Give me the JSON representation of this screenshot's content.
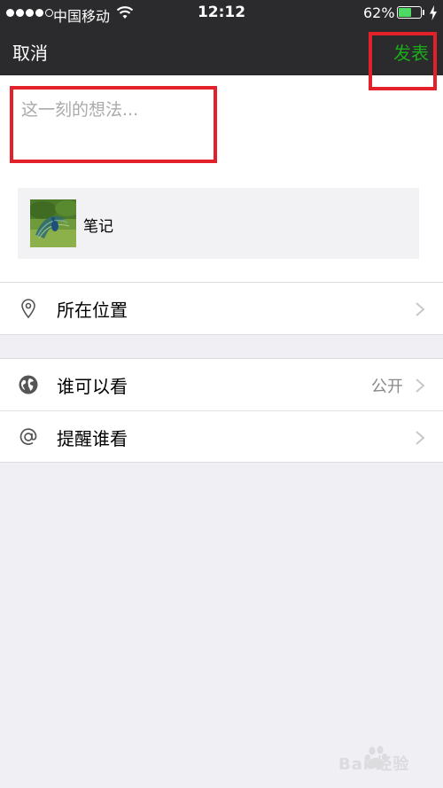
{
  "status_bar": {
    "carrier": "中国移动",
    "time": "12:12",
    "battery_percent": "62%",
    "battery_level": 0.62,
    "signal_bars_filled": 4,
    "signal_bars_total": 5
  },
  "nav": {
    "cancel_label": "取消",
    "publish_label": "发表"
  },
  "compose": {
    "text_value": "",
    "placeholder": "这一刻的想法...",
    "attachment_label": "笔记"
  },
  "location": {
    "label": "所在位置",
    "icon": "location-pin-icon"
  },
  "visibility": {
    "label": "谁可以看",
    "value": "公开",
    "icon": "globe-icon"
  },
  "mention": {
    "label": "提醒谁看",
    "icon": "at-sign-icon"
  },
  "watermark": {
    "logo_text": "Bai 经验"
  },
  "colors": {
    "nav_bg": "#2b2b2d",
    "publish_green": "#1aad19",
    "annotation_red": "#e3212b",
    "page_bg": "#efeff4"
  }
}
